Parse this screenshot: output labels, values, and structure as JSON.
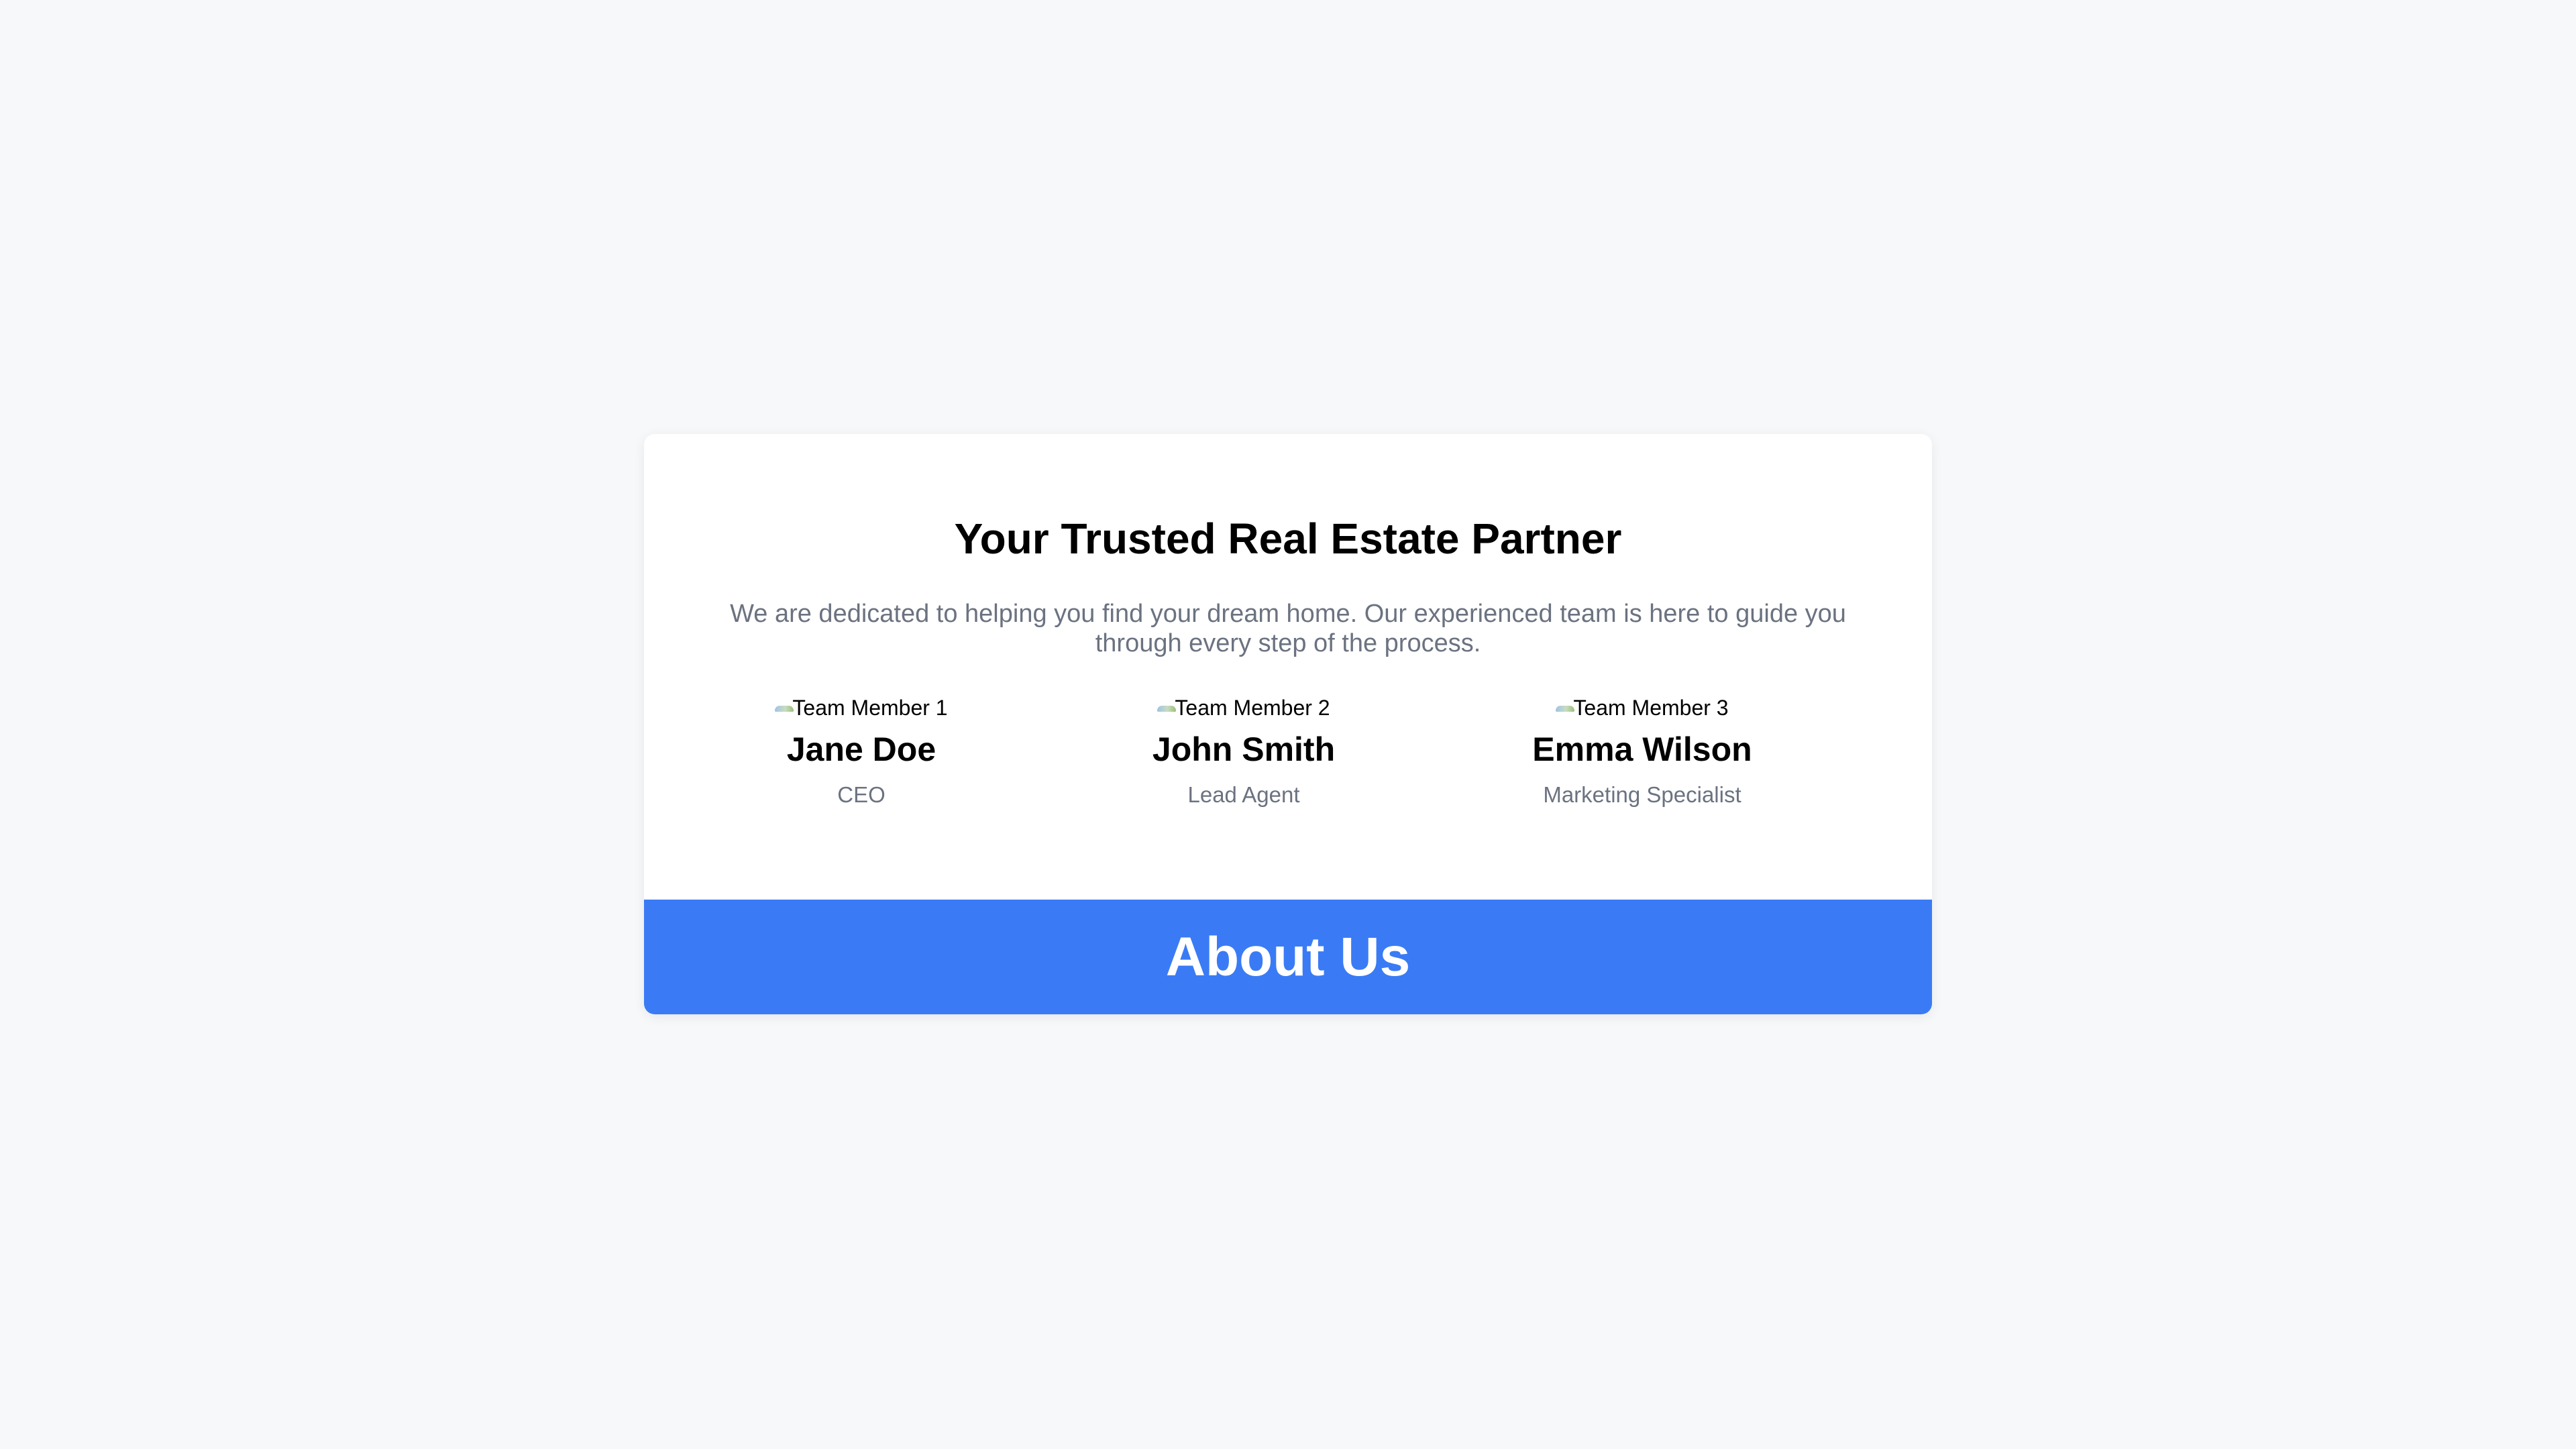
{
  "hero": {
    "title": "Your Trusted Real Estate Partner",
    "description": "We are dedicated to helping you find your dream home. Our experienced team is here to guide you through every step of the process."
  },
  "team": [
    {
      "image_alt": "Team Member 1",
      "name": "Jane Doe",
      "role": "CEO"
    },
    {
      "image_alt": "Team Member 2",
      "name": "John Smith",
      "role": "Lead Agent"
    },
    {
      "image_alt": "Team Member 3",
      "name": "Emma Wilson",
      "role": "Marketing Specialist"
    }
  ],
  "banner": {
    "title": "About Us"
  },
  "colors": {
    "background": "#f7f8fa",
    "card": "#ffffff",
    "banner": "#3a7bf5",
    "muted_text": "#6b7280"
  }
}
